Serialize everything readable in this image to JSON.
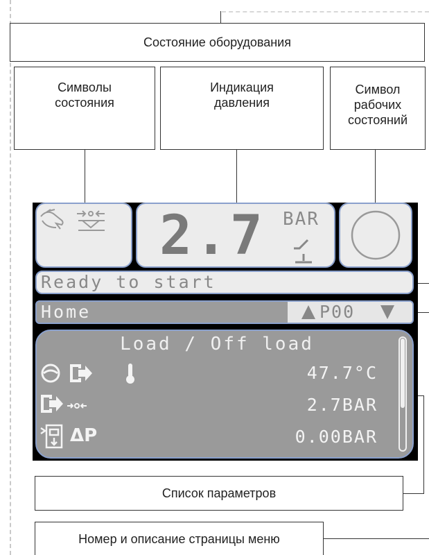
{
  "labels": {
    "equipment_state": "Состояние оборудования",
    "status_symbols": "Символы\nсостояния",
    "pressure_indication": "Индикация\nдавления",
    "operating_states_symbol": "Символ\nрабочих\nсостояний",
    "parameter_list": "Список параметров",
    "menu_page": "Номер и описание страницы меню"
  },
  "display": {
    "pressure_value": "2.7",
    "pressure_unit": "BAR",
    "status_text": "Ready to start",
    "menu_title": "Home",
    "page_code": "P00",
    "panel_title": "Load / Off load",
    "rows": [
      {
        "value": "47.7°C"
      },
      {
        "value": "2.7BAR"
      },
      {
        "value": "0.00BAR"
      }
    ],
    "delta_p": "ΔP"
  },
  "colors": {
    "tile_bg": "#ececec",
    "tile_border": "#8aa0cc",
    "panel_bg": "#9a9a9a",
    "screen_bg": "#000000"
  },
  "icons": [
    "hand-icon",
    "valve-icon",
    "pressure-switch-icon",
    "operating-state-ring-icon",
    "arrow-up-icon",
    "arrow-down-icon",
    "motor-icon",
    "outlet-icon",
    "thermometer-icon",
    "filter-icon"
  ]
}
